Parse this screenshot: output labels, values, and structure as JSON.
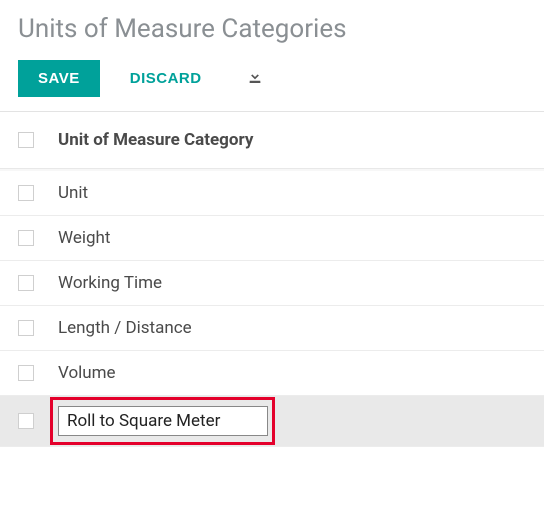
{
  "header": {
    "title": "Units of Measure Categories",
    "save_label": "SAVE",
    "discard_label": "DISCARD"
  },
  "table": {
    "column_header": "Unit of Measure Category",
    "rows": [
      {
        "label": "Unit"
      },
      {
        "label": "Weight"
      },
      {
        "label": "Working Time"
      },
      {
        "label": "Length / Distance"
      },
      {
        "label": "Volume"
      }
    ],
    "editing_row": {
      "value": "Roll to Square Meter"
    }
  }
}
